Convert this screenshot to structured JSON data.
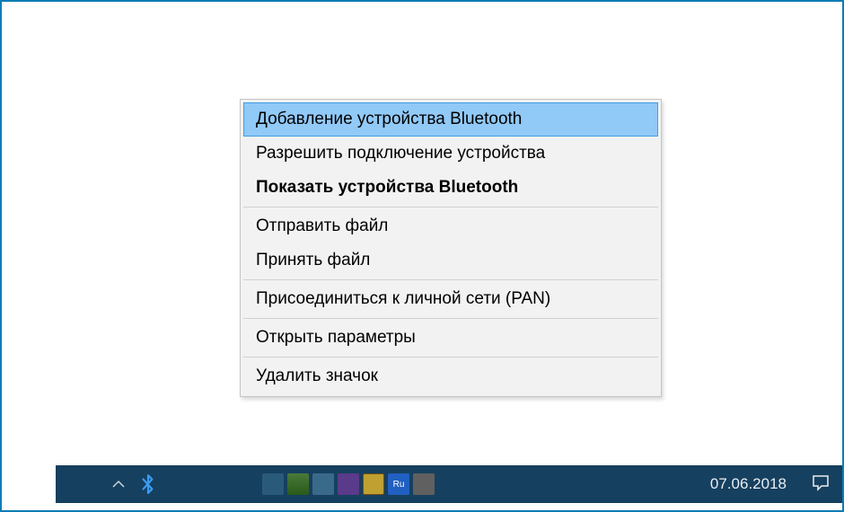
{
  "contextMenu": {
    "items": [
      {
        "label": "Добавление устройства Bluetooth",
        "highlighted": true,
        "bold": false
      },
      {
        "label": "Разрешить подключение устройства",
        "highlighted": false,
        "bold": false
      },
      {
        "label": "Показать устройства Bluetooth",
        "highlighted": false,
        "bold": true
      },
      {
        "label": "Отправить файл",
        "highlighted": false,
        "bold": false
      },
      {
        "label": "Принять файл",
        "highlighted": false,
        "bold": false
      },
      {
        "label": "Присоединиться к личной сети (PAN)",
        "highlighted": false,
        "bold": false
      },
      {
        "label": "Открыть параметры",
        "highlighted": false,
        "bold": false
      },
      {
        "label": "Удалить значок",
        "highlighted": false,
        "bold": false
      }
    ]
  },
  "taskbar": {
    "date": "07.06.2018"
  },
  "colors": {
    "taskbarBg": "#16405f",
    "menuBg": "#f2f2f2",
    "menuBorder": "#c5c5c5",
    "highlightBg": "#91c9f7",
    "highlightBorder": "#3d9de4"
  }
}
